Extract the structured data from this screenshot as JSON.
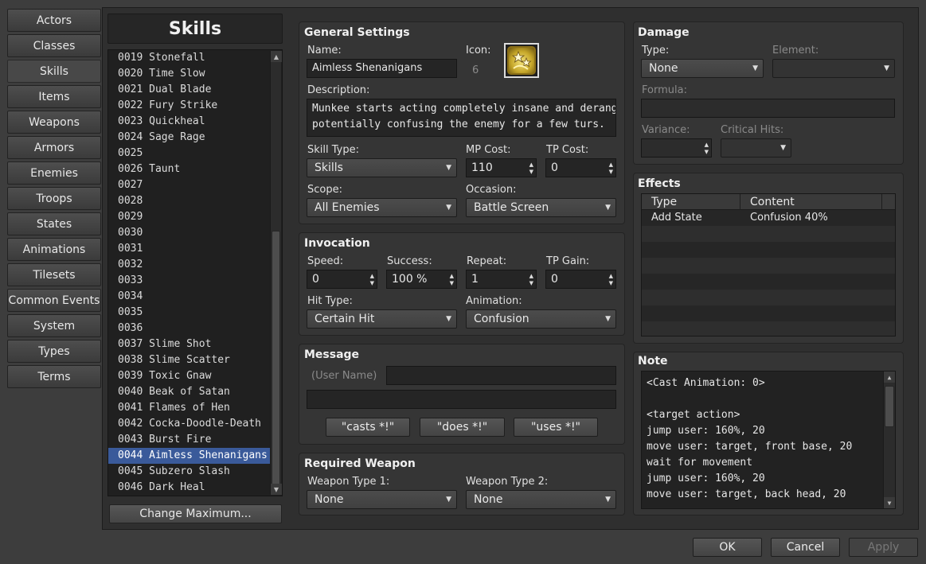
{
  "categories": [
    "Actors",
    "Classes",
    "Skills",
    "Items",
    "Weapons",
    "Armors",
    "Enemies",
    "Troops",
    "States",
    "Animations",
    "Tilesets",
    "Common Events",
    "System",
    "Types",
    "Terms"
  ],
  "list": {
    "title": "Skills",
    "items": [
      "0019 Stonefall",
      "0020 Time Slow",
      "0021 Dual Blade",
      "0022 Fury Strike",
      "0023 Quickheal",
      "0024 Sage Rage",
      "0025",
      "0026 Taunt",
      "0027",
      "0028",
      "0029",
      "0030",
      "0031",
      "0032",
      "0033",
      "0034",
      "0035",
      "0036",
      "0037 Slime Shot",
      "0038 Slime Scatter",
      "0039 Toxic Gnaw",
      "0040 Beak of Satan",
      "0041 Flames of Hen",
      "0042 Cocka-Doodle-Death",
      "0043 Burst Fire",
      "0044 Aimless Shenanigans",
      "0045 Subzero Slash",
      "0046 Dark Heal"
    ],
    "selected_index": 25,
    "change_max_label": "Change Maximum..."
  },
  "general": {
    "title": "General Settings",
    "name_label": "Name:",
    "name_value": "Aimless Shenanigans",
    "icon_label": "Icon:",
    "icon_index": "6",
    "desc_label": "Description:",
    "desc_line1": "Munkee starts acting completely insane and deranged,",
    "desc_line2": "potentially confusing the enemy for a few turs.",
    "skill_type_label": "Skill Type:",
    "skill_type_value": "Skills",
    "mp_label": "MP Cost:",
    "mp_value": "110",
    "tp_label": "TP Cost:",
    "tp_value": "0",
    "scope_label": "Scope:",
    "scope_value": "All Enemies",
    "occasion_label": "Occasion:",
    "occasion_value": "Battle Screen"
  },
  "invocation": {
    "title": "Invocation",
    "speed_label": "Speed:",
    "speed_value": "0",
    "success_label": "Success:",
    "success_value": "100 %",
    "repeat_label": "Repeat:",
    "repeat_value": "1",
    "tpgain_label": "TP Gain:",
    "tpgain_value": "0",
    "hit_label": "Hit Type:",
    "hit_value": "Certain Hit",
    "anim_label": "Animation:",
    "anim_value": "Confusion"
  },
  "message": {
    "title": "Message",
    "user_name_placeholder": "(User Name)",
    "line1_value": "",
    "line2_value": "",
    "btn_casts": "\"casts *!\"",
    "btn_does": "\"does *!\"",
    "btn_uses": "\"uses *!\""
  },
  "weapon": {
    "title": "Required Weapon",
    "type1_label": "Weapon Type 1:",
    "type1_value": "None",
    "type2_label": "Weapon Type 2:",
    "type2_value": "None"
  },
  "damage": {
    "title": "Damage",
    "type_label": "Type:",
    "type_value": "None",
    "element_label": "Element:",
    "element_value": "",
    "formula_label": "Formula:",
    "formula_value": "",
    "variance_label": "Variance:",
    "variance_value": "",
    "critical_label": "Critical Hits:",
    "critical_value": ""
  },
  "effects": {
    "title": "Effects",
    "col_type": "Type",
    "col_content": "Content",
    "rows": [
      {
        "type": "Add State",
        "content": "Confusion 40%"
      }
    ]
  },
  "note": {
    "title": "Note",
    "lines": [
      "<Cast Animation: 0>",
      "",
      "<target action>",
      "jump user: 160%, 20",
      "move user: target, front base, 20",
      "wait for movement",
      "jump user: 160%, 20",
      "move user: target, back head, 20"
    ]
  },
  "footer": {
    "ok": "OK",
    "cancel": "Cancel",
    "apply": "Apply"
  },
  "icons": {
    "skill_icon": "confusion-stars-icon",
    "dropdown": "chevron-down-icon",
    "spin": "spin-arrows-icon"
  },
  "colors": {
    "selection": "#3a5a9a",
    "background": "#3d3d3d"
  }
}
